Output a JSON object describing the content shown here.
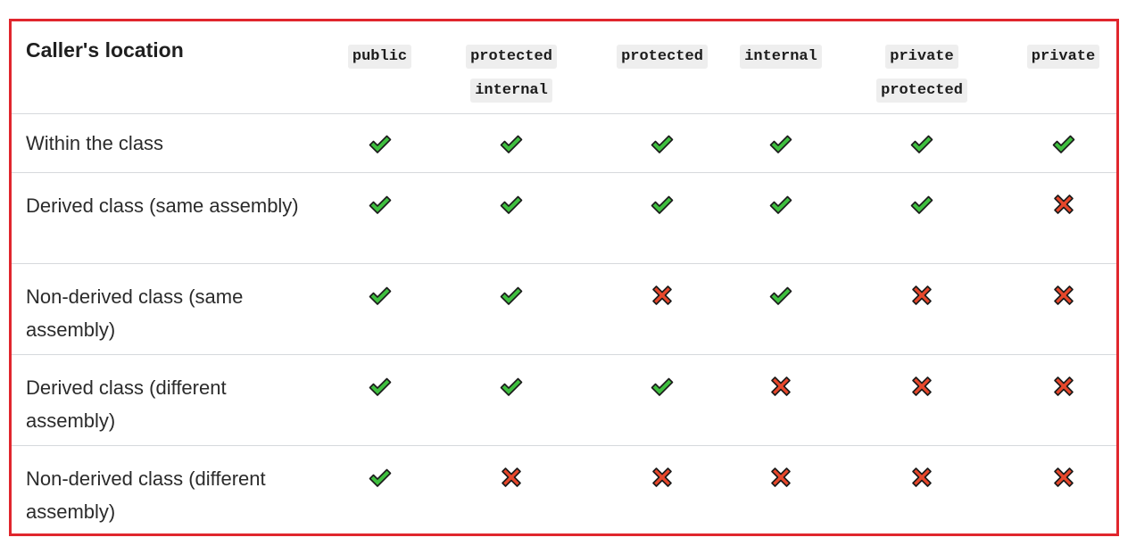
{
  "table": {
    "header_label": "Caller's location",
    "columns": [
      {
        "lines": [
          "public"
        ]
      },
      {
        "lines": [
          "protected",
          "internal"
        ]
      },
      {
        "lines": [
          "protected"
        ]
      },
      {
        "lines": [
          "internal"
        ]
      },
      {
        "lines": [
          "private",
          "protected"
        ]
      },
      {
        "lines": [
          "private"
        ]
      }
    ],
    "rows": [
      {
        "location": "Within the class",
        "access": [
          "yes",
          "yes",
          "yes",
          "yes",
          "yes",
          "yes"
        ]
      },
      {
        "location": "Derived class (same assembly)",
        "access": [
          "yes",
          "yes",
          "yes",
          "yes",
          "yes",
          "no"
        ]
      },
      {
        "location": "Non-derived class (same assembly)",
        "access": [
          "yes",
          "yes",
          "no",
          "yes",
          "no",
          "no"
        ]
      },
      {
        "location": "Derived class (different assembly)",
        "access": [
          "yes",
          "yes",
          "yes",
          "no",
          "no",
          "no"
        ]
      },
      {
        "location": "Non-derived class (different assembly)",
        "access": [
          "yes",
          "no",
          "no",
          "no",
          "no",
          "no"
        ]
      }
    ]
  },
  "icons": {
    "yes": "check-mark-icon",
    "no": "cross-mark-icon"
  },
  "colors": {
    "frame": "#e0262d",
    "check": "#3fbf3f",
    "cross": "#e8472b",
    "outline": "#1a1a1a"
  }
}
